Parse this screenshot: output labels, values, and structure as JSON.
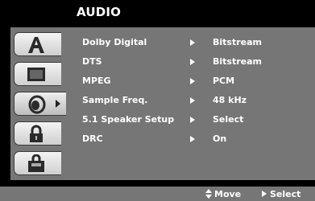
{
  "screen": {
    "title": "AUDIO"
  },
  "tabs": [
    {
      "icon": "language-icon",
      "active": false
    },
    {
      "icon": "display-icon",
      "active": false
    },
    {
      "icon": "audio-speaker-icon",
      "active": true
    },
    {
      "icon": "lock-icon",
      "active": false
    },
    {
      "icon": "other-settings-icon",
      "active": false
    }
  ],
  "menu": {
    "rows": [
      {
        "label": "Dolby Digital",
        "value": "Bitstream"
      },
      {
        "label": "DTS",
        "value": "Bitstream"
      },
      {
        "label": "MPEG",
        "value": "PCM"
      },
      {
        "label": "Sample Freq.",
        "value": "48 kHz"
      },
      {
        "label": "5.1 Speaker Setup",
        "value": "Select"
      },
      {
        "label": "DRC",
        "value": "On"
      }
    ]
  },
  "footer": {
    "move_label": "Move",
    "select_label": "Select"
  }
}
